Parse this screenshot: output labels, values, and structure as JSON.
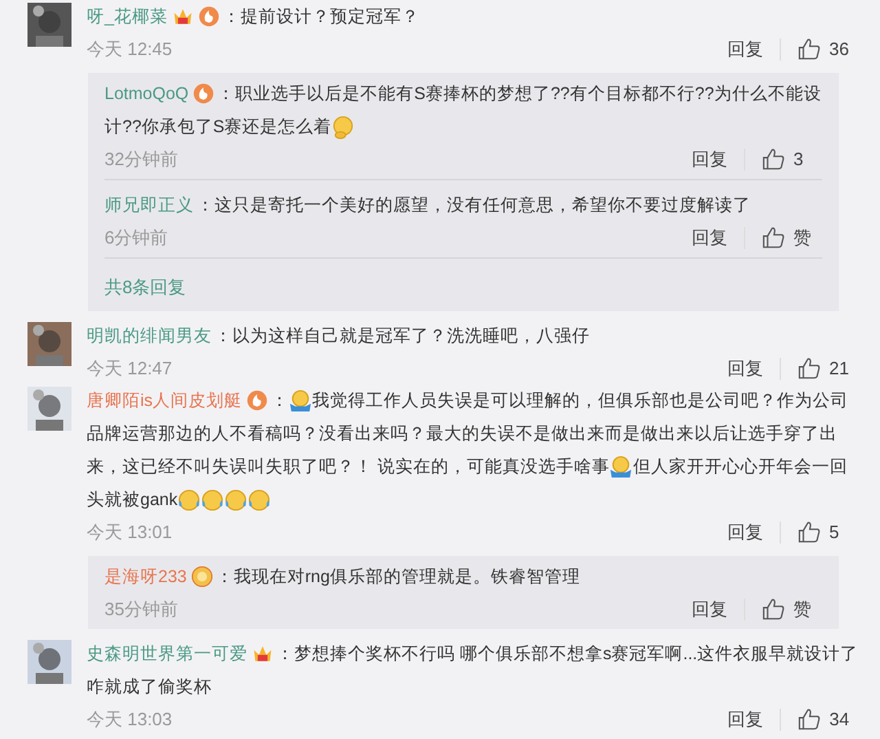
{
  "comments": [
    {
      "user": "呀_花椰菜",
      "color": "#4c9a83",
      "badges": [
        {
          "kind": "crown"
        },
        {
          "kind": "flame"
        }
      ],
      "colon": "：",
      "lines": [
        [
          {
            "kind": "text",
            "text": "提前设计？预定冠军？"
          }
        ]
      ],
      "time": "今天 12:45",
      "reply_label": "回复",
      "likes": "36",
      "replies": [
        {
          "user": "LotmoQoQ",
          "color": "#4c9a83",
          "badges": [
            {
              "kind": "flame"
            }
          ],
          "colon": "：",
          "lines": [
            [
              {
                "kind": "text",
                "text": "职业选手以后是不能有S赛捧杯的梦想了??有个目标都不行??为什么不能设"
              }
            ],
            [
              {
                "kind": "text",
                "text": "计??你承包了S赛还是怎么着"
              },
              {
                "kind": "thinking"
              }
            ]
          ],
          "time": "32分钟前",
          "reply_label": "回复",
          "likes": "3"
        },
        {
          "user": "师兄即正义",
          "color": "#4c9a83",
          "colon": "：",
          "lines": [
            [
              {
                "kind": "text",
                "text": "这只是寄托一个美好的愿望，没有任何意思，希望你不要过度解读了"
              }
            ]
          ],
          "time": "6分钟前",
          "reply_label": "回复",
          "likes": "赞"
        }
      ],
      "more_replies": "共8条回复"
    },
    {
      "user": "明凯的绯闻男友",
      "color": "#4c9a83",
      "colon": "：",
      "lines": [
        [
          {
            "kind": "text",
            "text": "以为这样自己就是冠军了？洗洗睡吧，八强仔"
          }
        ]
      ],
      "time": "今天 12:47",
      "reply_label": "回复",
      "likes": "21"
    },
    {
      "user": "唐卿陌is人间皮划艇",
      "color": "#e8744e",
      "badges": [
        {
          "kind": "flame"
        }
      ],
      "colon": "：",
      "lines": [
        [
          {
            "kind": "shrug"
          },
          {
            "kind": "text",
            "text": "我觉得工作人员失误是可以理解的，但俱乐部也是公司吧？作为公司"
          }
        ],
        [
          {
            "kind": "text",
            "text": "品牌运营那边的人不看稿吗？没看出来吗？最大的失误不是做出来而是做出来以后让选手穿了出"
          }
        ],
        [
          {
            "kind": "text",
            "text": "来，这已经不叫失误叫失职了吧？！ 说实在的，可能真没选手啥事"
          },
          {
            "kind": "shrug"
          },
          {
            "kind": "text",
            "text": "但人家开开心心开年会一回"
          }
        ],
        [
          {
            "kind": "text",
            "text": "头就被gank"
          },
          {
            "kind": "laughing"
          },
          {
            "kind": "laughing"
          },
          {
            "kind": "laughing"
          },
          {
            "kind": "laughing"
          }
        ]
      ],
      "time": "今天 13:01",
      "reply_label": "回复",
      "likes": "5",
      "replies": [
        {
          "user": "是海呀233",
          "color": "#e8744e",
          "badges": [
            {
              "kind": "medal"
            }
          ],
          "colon": "：",
          "lines": [
            [
              {
                "kind": "text",
                "text": "我现在对rng俱乐部的管理就是。铁睿智管理"
              }
            ]
          ],
          "time": "35分钟前",
          "reply_label": "回复",
          "likes": "赞"
        }
      ]
    },
    {
      "user": "史森明世界第一可爱",
      "color": "#4c9a83",
      "badges": [
        {
          "kind": "crown"
        }
      ],
      "colon": "：",
      "lines": [
        [
          {
            "kind": "text",
            "text": "梦想捧个奖杯不行吗 哪个俱乐部不想拿s赛冠军啊...这件衣服早就设计了"
          }
        ],
        [
          {
            "kind": "text",
            "text": "咋就成了偷奖杯"
          }
        ]
      ],
      "time": "今天 13:03",
      "reply_label": "回复",
      "likes": "34"
    }
  ]
}
